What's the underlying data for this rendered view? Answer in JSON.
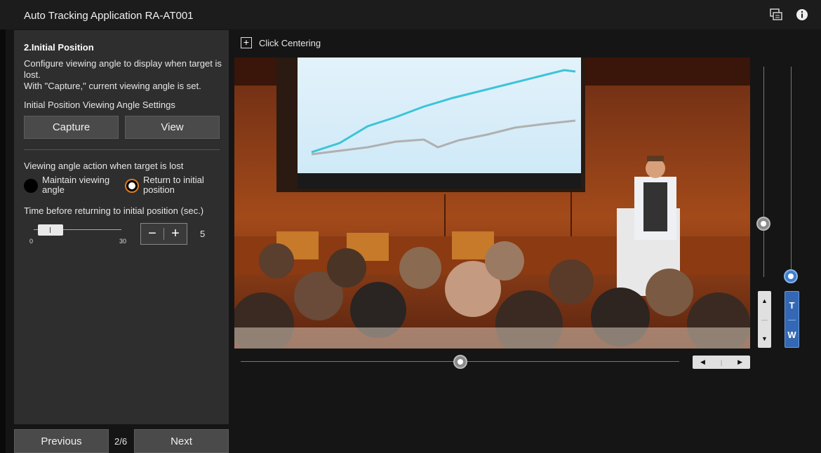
{
  "app": {
    "title": "Auto Tracking Application RA-AT001"
  },
  "titlebar": {
    "icons": [
      "chat-icon",
      "info-icon"
    ]
  },
  "panel": {
    "title": "2.Initial Position",
    "description": "Configure viewing angle to display when target is lost.\nWith \"Capture,\" current viewing angle is set.",
    "subheading": "Initial Position Viewing Angle Settings",
    "capture_label": "Capture",
    "view_label": "View",
    "lost_action_label": "Viewing angle action when target is lost",
    "option_maintain": "Maintain viewing angle",
    "option_return": "Return to initial position",
    "selected_option": "Return to initial position",
    "time_label": "Time before returning to initial position (sec.)",
    "slider_min": "0",
    "slider_max": "30",
    "time_value": "5",
    "stepper_minus": "−",
    "stepper_plus": "+"
  },
  "nav": {
    "previous_label": "Previous",
    "next_label": "Next",
    "page_indicator": "2/6"
  },
  "video": {
    "click_centering_label": "Click Centering",
    "click_centering_icon": "+"
  },
  "controls": {
    "zoom_tele": "T",
    "zoom_wide": "W",
    "accent_color": "#3468b5",
    "radio_selected_color": "#e07a1c"
  }
}
